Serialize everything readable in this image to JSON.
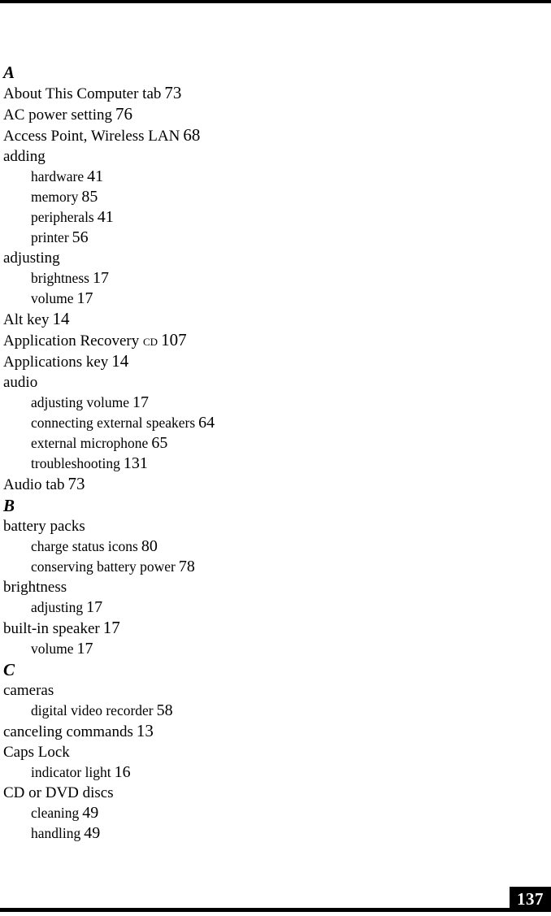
{
  "document": {
    "type": "index",
    "folio": "137"
  },
  "index": {
    "sections": [
      {
        "heading": "A",
        "entries": [
          {
            "level": "main",
            "text": "About This Computer tab",
            "page": "73"
          },
          {
            "level": "main",
            "text": "AC power setting",
            "page": "76"
          },
          {
            "level": "main",
            "text": "Access Point, Wireless LAN",
            "page": "68"
          },
          {
            "level": "main",
            "text": "adding",
            "page": ""
          },
          {
            "level": "sub",
            "text": "hardware",
            "page": "41"
          },
          {
            "level": "sub",
            "text": "memory",
            "page": "85"
          },
          {
            "level": "sub",
            "text": "peripherals",
            "page": "41"
          },
          {
            "level": "sub",
            "text": "printer",
            "page": "56"
          },
          {
            "level": "main",
            "text": "adjusting",
            "page": ""
          },
          {
            "level": "sub",
            "text": "brightness",
            "page": "17"
          },
          {
            "level": "sub",
            "text": "volume",
            "page": "17"
          },
          {
            "level": "main",
            "text": "Alt key",
            "page": "14"
          },
          {
            "level": "main",
            "text": "Application Recovery ",
            "smallcaps": "CD",
            "page": "107"
          },
          {
            "level": "main",
            "text": "Applications key",
            "page": "14"
          },
          {
            "level": "main",
            "text": "audio",
            "page": ""
          },
          {
            "level": "sub",
            "text": "adjusting volume",
            "page": "17"
          },
          {
            "level": "sub",
            "text": "connecting external speakers",
            "page": "64"
          },
          {
            "level": "sub",
            "text": "external microphone",
            "page": "65"
          },
          {
            "level": "sub",
            "text": "troubleshooting",
            "page": "131"
          },
          {
            "level": "main",
            "text": "Audio tab",
            "page": "73"
          }
        ]
      },
      {
        "heading": "B",
        "entries": [
          {
            "level": "main",
            "text": "battery packs",
            "page": ""
          },
          {
            "level": "sub",
            "text": "charge status icons",
            "page": "80"
          },
          {
            "level": "sub",
            "text": "conserving battery power",
            "page": "78"
          },
          {
            "level": "main",
            "text": "brightness",
            "page": ""
          },
          {
            "level": "sub",
            "text": "adjusting",
            "page": "17"
          },
          {
            "level": "main",
            "text": "built-in speaker",
            "page": "17"
          },
          {
            "level": "sub",
            "text": "volume",
            "page": "17"
          }
        ]
      },
      {
        "heading": "C",
        "entries": [
          {
            "level": "main",
            "text": "cameras",
            "page": ""
          },
          {
            "level": "sub",
            "text": "digital video recorder",
            "page": "58"
          },
          {
            "level": "main",
            "text": "canceling commands",
            "page": "13"
          },
          {
            "level": "main",
            "text": "Caps Lock",
            "page": ""
          },
          {
            "level": "sub",
            "text": "indicator light",
            "page": "16"
          },
          {
            "level": "main",
            "text": "CD or DVD discs",
            "page": ""
          },
          {
            "level": "sub",
            "text": "cleaning",
            "page": "49"
          },
          {
            "level": "sub",
            "text": "handling",
            "page": "49"
          }
        ]
      }
    ]
  }
}
